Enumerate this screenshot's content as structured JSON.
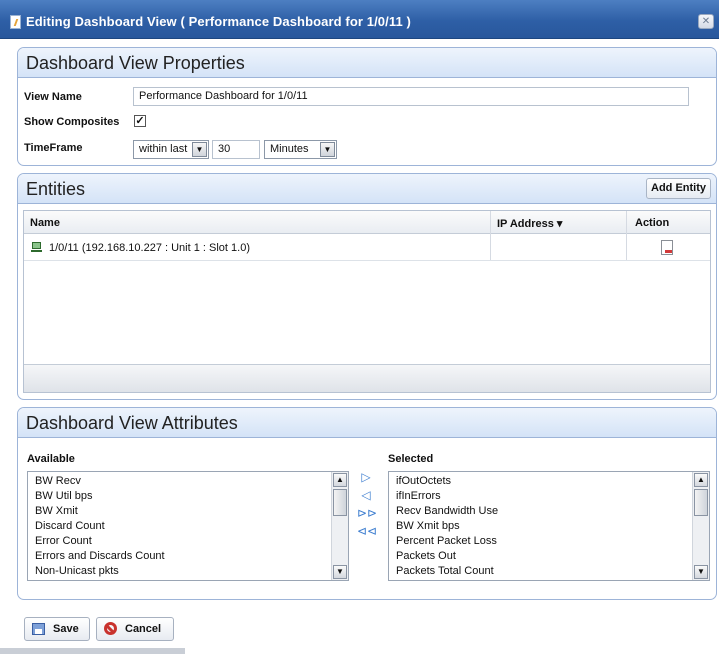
{
  "window": {
    "title": "Editing Dashboard View ( Performance Dashboard for 1/0/11 )",
    "close_glyph": "✕"
  },
  "properties": {
    "section_title": "Dashboard View Properties",
    "view_name_label": "View Name",
    "view_name_value": "Performance Dashboard for 1/0/11",
    "show_composites_label": "Show Composites",
    "show_composites_checked": true,
    "show_composites_glyph": "✓",
    "timeframe_label": "TimeFrame",
    "timeframe_mode": "within last",
    "timeframe_amount": "30",
    "timeframe_unit": "Minutes"
  },
  "entities": {
    "section_title": "Entities",
    "add_button": "Add Entity",
    "columns": {
      "name": "Name",
      "ip": "IP Address",
      "action": "Action"
    },
    "rows": [
      {
        "name": "1/0/11 (192.168.10.227 : Unit 1 : Slot 1.0)",
        "ip": ""
      }
    ]
  },
  "attributes": {
    "section_title": "Dashboard View Attributes",
    "available_label": "Available",
    "selected_label": "Selected",
    "available": [
      "BW Recv",
      "BW Util bps",
      "BW Xmit",
      "Discard Count",
      "Error Count",
      "Errors and Discards Count",
      "Non-Unicast pkts"
    ],
    "selected": [
      "ifOutOctets",
      "ifInErrors",
      "Recv Bandwidth Use",
      "BW Xmit bps",
      "Percent Packet Loss",
      "Packets Out",
      "Packets Total Count"
    ],
    "move_glyphs": {
      "add": "▷",
      "remove": "◁",
      "add_all": "⊳⊳",
      "remove_all": "⊲⊲"
    }
  },
  "footer": {
    "save": "Save",
    "cancel": "Cancel"
  },
  "colors": {
    "titlebar": "#2e5fa6",
    "panel_header": "#d4e3f7",
    "accent_arrow": "#3f7fd0",
    "cancel_icon": "#c9332e"
  }
}
